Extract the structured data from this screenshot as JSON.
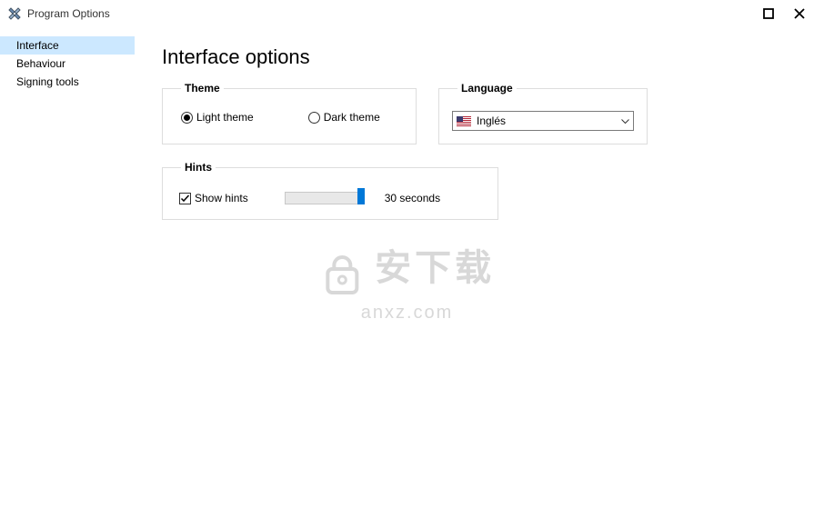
{
  "window": {
    "title": "Program Options"
  },
  "sidebar": {
    "items": [
      {
        "label": "Interface",
        "selected": true
      },
      {
        "label": "Behaviour",
        "selected": false
      },
      {
        "label": "Signing tools",
        "selected": false
      }
    ]
  },
  "page": {
    "title": "Interface options"
  },
  "theme": {
    "legend": "Theme",
    "light_label": "Light theme",
    "dark_label": "Dark theme",
    "selected": "light"
  },
  "language": {
    "legend": "Language",
    "selected": "Inglés",
    "flag": "us"
  },
  "hints": {
    "legend": "Hints",
    "show_label": "Show hints",
    "show_checked": true,
    "slider_value": 30,
    "slider_max": 30,
    "duration_label": "30 seconds"
  },
  "watermark": {
    "cn": "安下载",
    "en": "anxz.com"
  }
}
